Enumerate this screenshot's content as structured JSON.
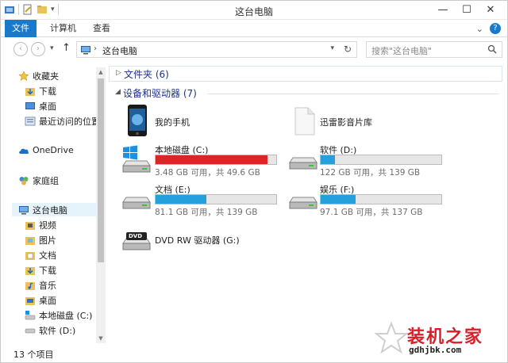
{
  "window": {
    "title": "这台电脑",
    "controls": {
      "minimize": "—",
      "maximize": "☐",
      "close": "✕"
    }
  },
  "ribbon": {
    "tabs": [
      "文件",
      "计算机",
      "查看"
    ],
    "expand_glyph": "⌄",
    "help": "?"
  },
  "address": {
    "back": "‹",
    "forward": "›",
    "dropdown": "▾",
    "up": "↑",
    "breadcrumb": "这台电脑",
    "crumb_sep": "›",
    "refresh": "↻",
    "search_placeholder": "搜索\"这台电脑\""
  },
  "nav": {
    "favorites": "收藏夹",
    "favorites_items": [
      "下载",
      "桌面",
      "最近访问的位置"
    ],
    "onedrive": "OneDrive",
    "homegroup": "家庭组",
    "this_pc": "这台电脑",
    "this_pc_items": [
      "视频",
      "图片",
      "文档",
      "下载",
      "音乐",
      "桌面",
      "本地磁盘 (C:)",
      "软件 (D:)"
    ]
  },
  "content": {
    "folders_header": "文件夹 (6)",
    "devices_header": "设备和驱动器 (7)",
    "devices": [
      {
        "name": "我的手机"
      },
      {
        "name": "迅雷影音片库"
      }
    ],
    "drives": [
      {
        "name": "本地磁盘 (C:)",
        "free_text": "3.48 GB 可用，共 49.6 GB",
        "used_fraction": 0.93,
        "fill_color": "#da2626"
      },
      {
        "name": "软件 (D:)",
        "free_text": "122 GB 可用，共 139 GB",
        "used_fraction": 0.12,
        "fill_color": "#26a0da"
      },
      {
        "name": "文档 (E:)",
        "free_text": "81.1 GB 可用，共 139 GB",
        "used_fraction": 0.42,
        "fill_color": "#26a0da"
      },
      {
        "name": "娱乐 (F:)",
        "free_text": "97.1 GB 可用，共 137 GB",
        "used_fraction": 0.29,
        "fill_color": "#26a0da"
      }
    ],
    "dvd": {
      "name": "DVD RW 驱动器 (G:)",
      "label": "DVD"
    }
  },
  "status": {
    "items": "13 个项目"
  },
  "watermark": {
    "title": "装机之家",
    "url": "gdhjbk.com"
  },
  "colors": {
    "accent": "#1979ca",
    "warn_fill": "#da2626",
    "normal_fill": "#26a0da",
    "header_text": "#1e3287"
  }
}
